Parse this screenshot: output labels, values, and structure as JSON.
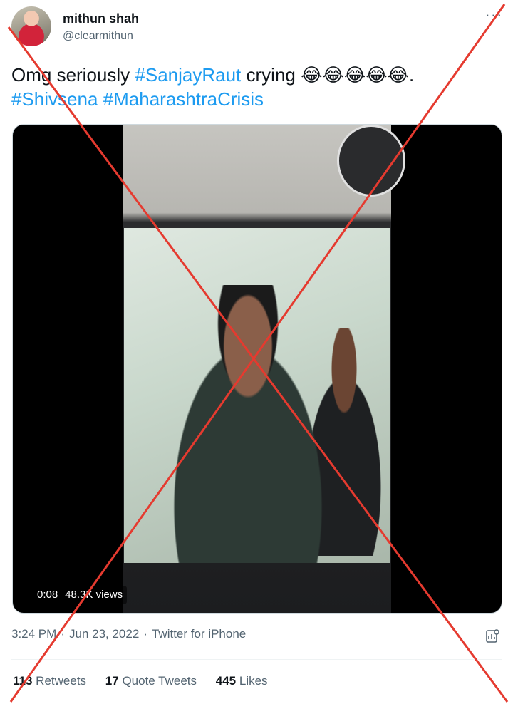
{
  "author": {
    "name": "mithun shah",
    "handle": "@clearmithun"
  },
  "tweet": {
    "text_prefix": "Omg seriously ",
    "hashtag1": "#SanjayRaut",
    "text_middle": " crying ",
    "emojis": "😂😂😂😂😂.",
    "hashtag2": "#Shivsena",
    "hashtag3": "#MaharashtraCrisis"
  },
  "media": {
    "duration": "0:08",
    "views": "48.3K views",
    "icon": "video-thumbnail"
  },
  "meta": {
    "time": "3:24 PM",
    "date": "Jun 23, 2022",
    "source": "Twitter for iPhone",
    "separator": "·"
  },
  "stats": {
    "retweets_count": "113",
    "retweets_label": "Retweets",
    "quotes_count": "17",
    "quotes_label": "Quote Tweets",
    "likes_count": "445",
    "likes_label": "Likes"
  },
  "overlay": {
    "cross_color": "#e53a2f"
  }
}
